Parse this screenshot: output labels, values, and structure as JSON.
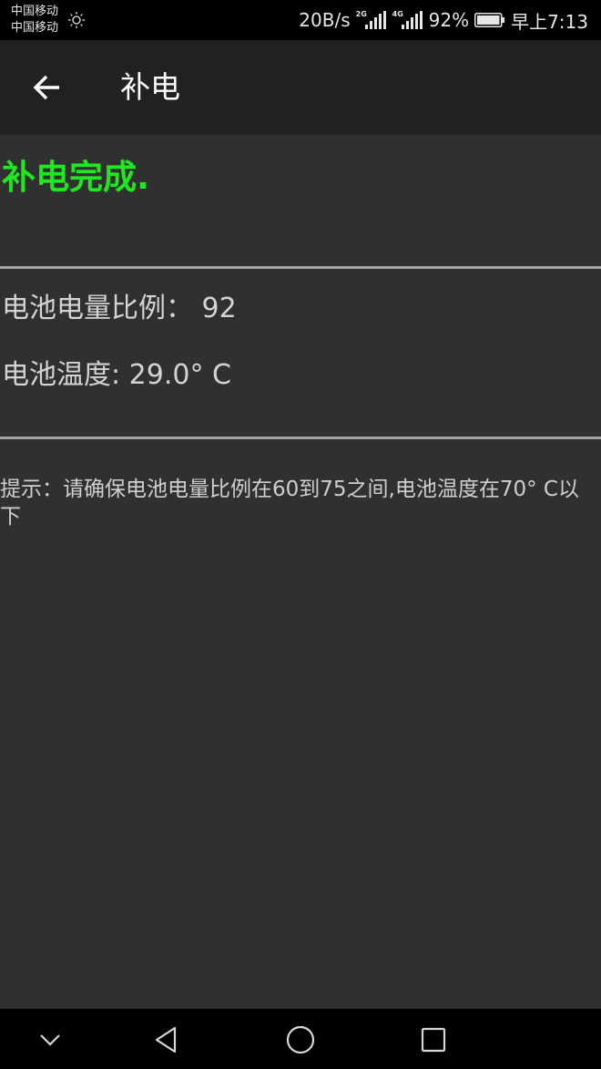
{
  "status_bar": {
    "carrier_1": "中国移动",
    "carrier_2": "中国移动",
    "net_speed": "20B/s",
    "signal_1_tag": "2G",
    "signal_2_tag": "4G",
    "battery_percent": "92%",
    "time": "早上7:13",
    "icons": [
      "sun-icon",
      "signal-icon",
      "battery-icon"
    ]
  },
  "app_bar": {
    "title": "补电",
    "back_icon": "arrow-left-icon"
  },
  "main": {
    "status_message": "补电完成.",
    "battery_ratio": "电池电量比例： 92",
    "battery_temp": "电池温度: 29.0° C",
    "hint": "提示：请确保电池电量比例在60到75之间,电池温度在70° C以下"
  },
  "colors": {
    "status_green": "#1ee81e",
    "app_bar": "#212121",
    "background": "#303030"
  },
  "nav_bar": {
    "icons": [
      "chevron-down-icon",
      "back-triangle-icon",
      "home-circle-icon",
      "recents-square-icon"
    ]
  }
}
